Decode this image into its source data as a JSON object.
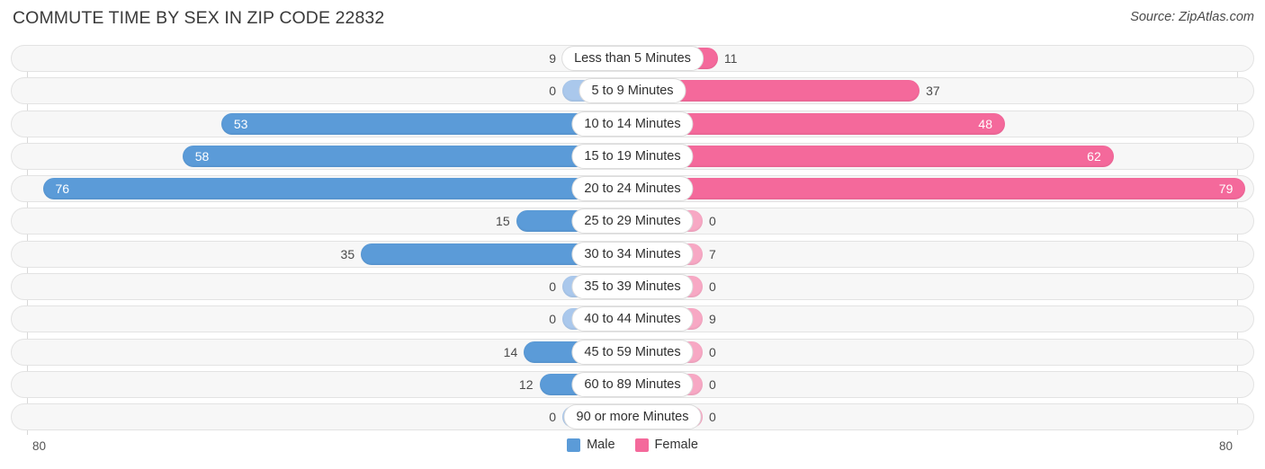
{
  "header": {
    "title": "COMMUTE TIME BY SEX IN ZIP CODE 22832",
    "source": "Source: ZipAtlas.com"
  },
  "axis": {
    "left_label": "80",
    "right_label": "80"
  },
  "legend": {
    "male_label": "Male",
    "female_label": "Female",
    "male_color": "#5b9bd8",
    "female_color": "#f4699b"
  },
  "colors": {
    "male_strong": "#5b9bd8",
    "male_light": "#aac8ec",
    "female_strong": "#f4699b",
    "female_light": "#f7a8c4",
    "track": "#f7f7f7",
    "track_border": "#e3e3e3",
    "gridline": "#d8d8d8"
  },
  "chart_data": {
    "type": "bar",
    "title": "COMMUTE TIME BY SEX IN ZIP CODE 22832",
    "subtitle": "",
    "orientation": "horizontal-diverging",
    "xlabel": "",
    "ylabel": "",
    "xlim": [
      80,
      80
    ],
    "grid": true,
    "legend_position": "bottom-center",
    "categories": [
      "Less than 5 Minutes",
      "5 to 9 Minutes",
      "10 to 14 Minutes",
      "15 to 19 Minutes",
      "20 to 24 Minutes",
      "25 to 29 Minutes",
      "30 to 34 Minutes",
      "35 to 39 Minutes",
      "40 to 44 Minutes",
      "45 to 59 Minutes",
      "60 to 89 Minutes",
      "90 or more Minutes"
    ],
    "series": [
      {
        "name": "Male",
        "values": [
          9,
          0,
          53,
          58,
          76,
          15,
          35,
          0,
          0,
          14,
          12,
          0
        ]
      },
      {
        "name": "Female",
        "values": [
          11,
          37,
          48,
          62,
          79,
          0,
          7,
          0,
          9,
          0,
          0,
          0
        ]
      }
    ]
  },
  "rows": [
    {
      "category": "Less than 5 Minutes",
      "male": "9",
      "female": "11"
    },
    {
      "category": "5 to 9 Minutes",
      "male": "0",
      "female": "37"
    },
    {
      "category": "10 to 14 Minutes",
      "male": "53",
      "female": "48"
    },
    {
      "category": "15 to 19 Minutes",
      "male": "58",
      "female": "62"
    },
    {
      "category": "20 to 24 Minutes",
      "male": "76",
      "female": "79"
    },
    {
      "category": "25 to 29 Minutes",
      "male": "15",
      "female": "0"
    },
    {
      "category": "30 to 34 Minutes",
      "male": "35",
      "female": "7"
    },
    {
      "category": "35 to 39 Minutes",
      "male": "0",
      "female": "0"
    },
    {
      "category": "40 to 44 Minutes",
      "male": "0",
      "female": "9"
    },
    {
      "category": "45 to 59 Minutes",
      "male": "14",
      "female": "0"
    },
    {
      "category": "60 to 89 Minutes",
      "male": "12",
      "female": "0"
    },
    {
      "category": "90 or more Minutes",
      "male": "0",
      "female": "0"
    }
  ]
}
